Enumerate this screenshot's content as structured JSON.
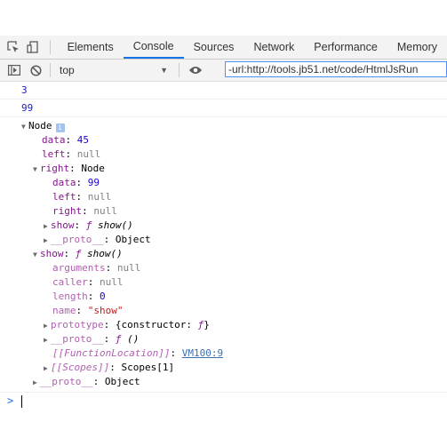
{
  "tabs": [
    "Elements",
    "Console",
    "Sources",
    "Network",
    "Performance",
    "Memory"
  ],
  "active_tab": "Console",
  "toolbar": {
    "context": "top",
    "filter_value": "-url:http://tools.jb51.net/code/HtmlJsRun"
  },
  "messages": [
    "3",
    "99"
  ],
  "tree": {
    "root_label": "Node",
    "l1": {
      "key": "data",
      "val": "45"
    },
    "l2": {
      "key": "left",
      "val": "null"
    },
    "l3": {
      "key": "right",
      "val": "Node"
    },
    "l4": {
      "key": "data",
      "val": "99"
    },
    "l5": {
      "key": "left",
      "val": "null"
    },
    "l6": {
      "key": "right",
      "val": "null"
    },
    "l7": {
      "key": "show",
      "val1": "ƒ",
      "val2": "show()"
    },
    "l8": {
      "key": "__proto__",
      "val": "Object"
    },
    "l9": {
      "key": "show",
      "val1": "ƒ",
      "val2": "show()"
    },
    "l10": {
      "key": "arguments",
      "val": "null"
    },
    "l11": {
      "key": "caller",
      "val": "null"
    },
    "l12": {
      "key": "length",
      "val": "0"
    },
    "l13": {
      "key": "name",
      "val": "\"show\""
    },
    "l14": {
      "key": "prototype",
      "val1": "{constructor: ",
      "val2": "ƒ",
      "val3": "}"
    },
    "l15": {
      "key": "__proto__",
      "val1": "ƒ",
      "val2": "()"
    },
    "l16": {
      "key": "[[FunctionLocation]]",
      "val": "VM100:9"
    },
    "l17": {
      "key": "[[Scopes]]",
      "val": "Scopes[1]"
    },
    "l18": {
      "key": "__proto__",
      "val": "Object"
    }
  },
  "prompt_symbol": ">"
}
